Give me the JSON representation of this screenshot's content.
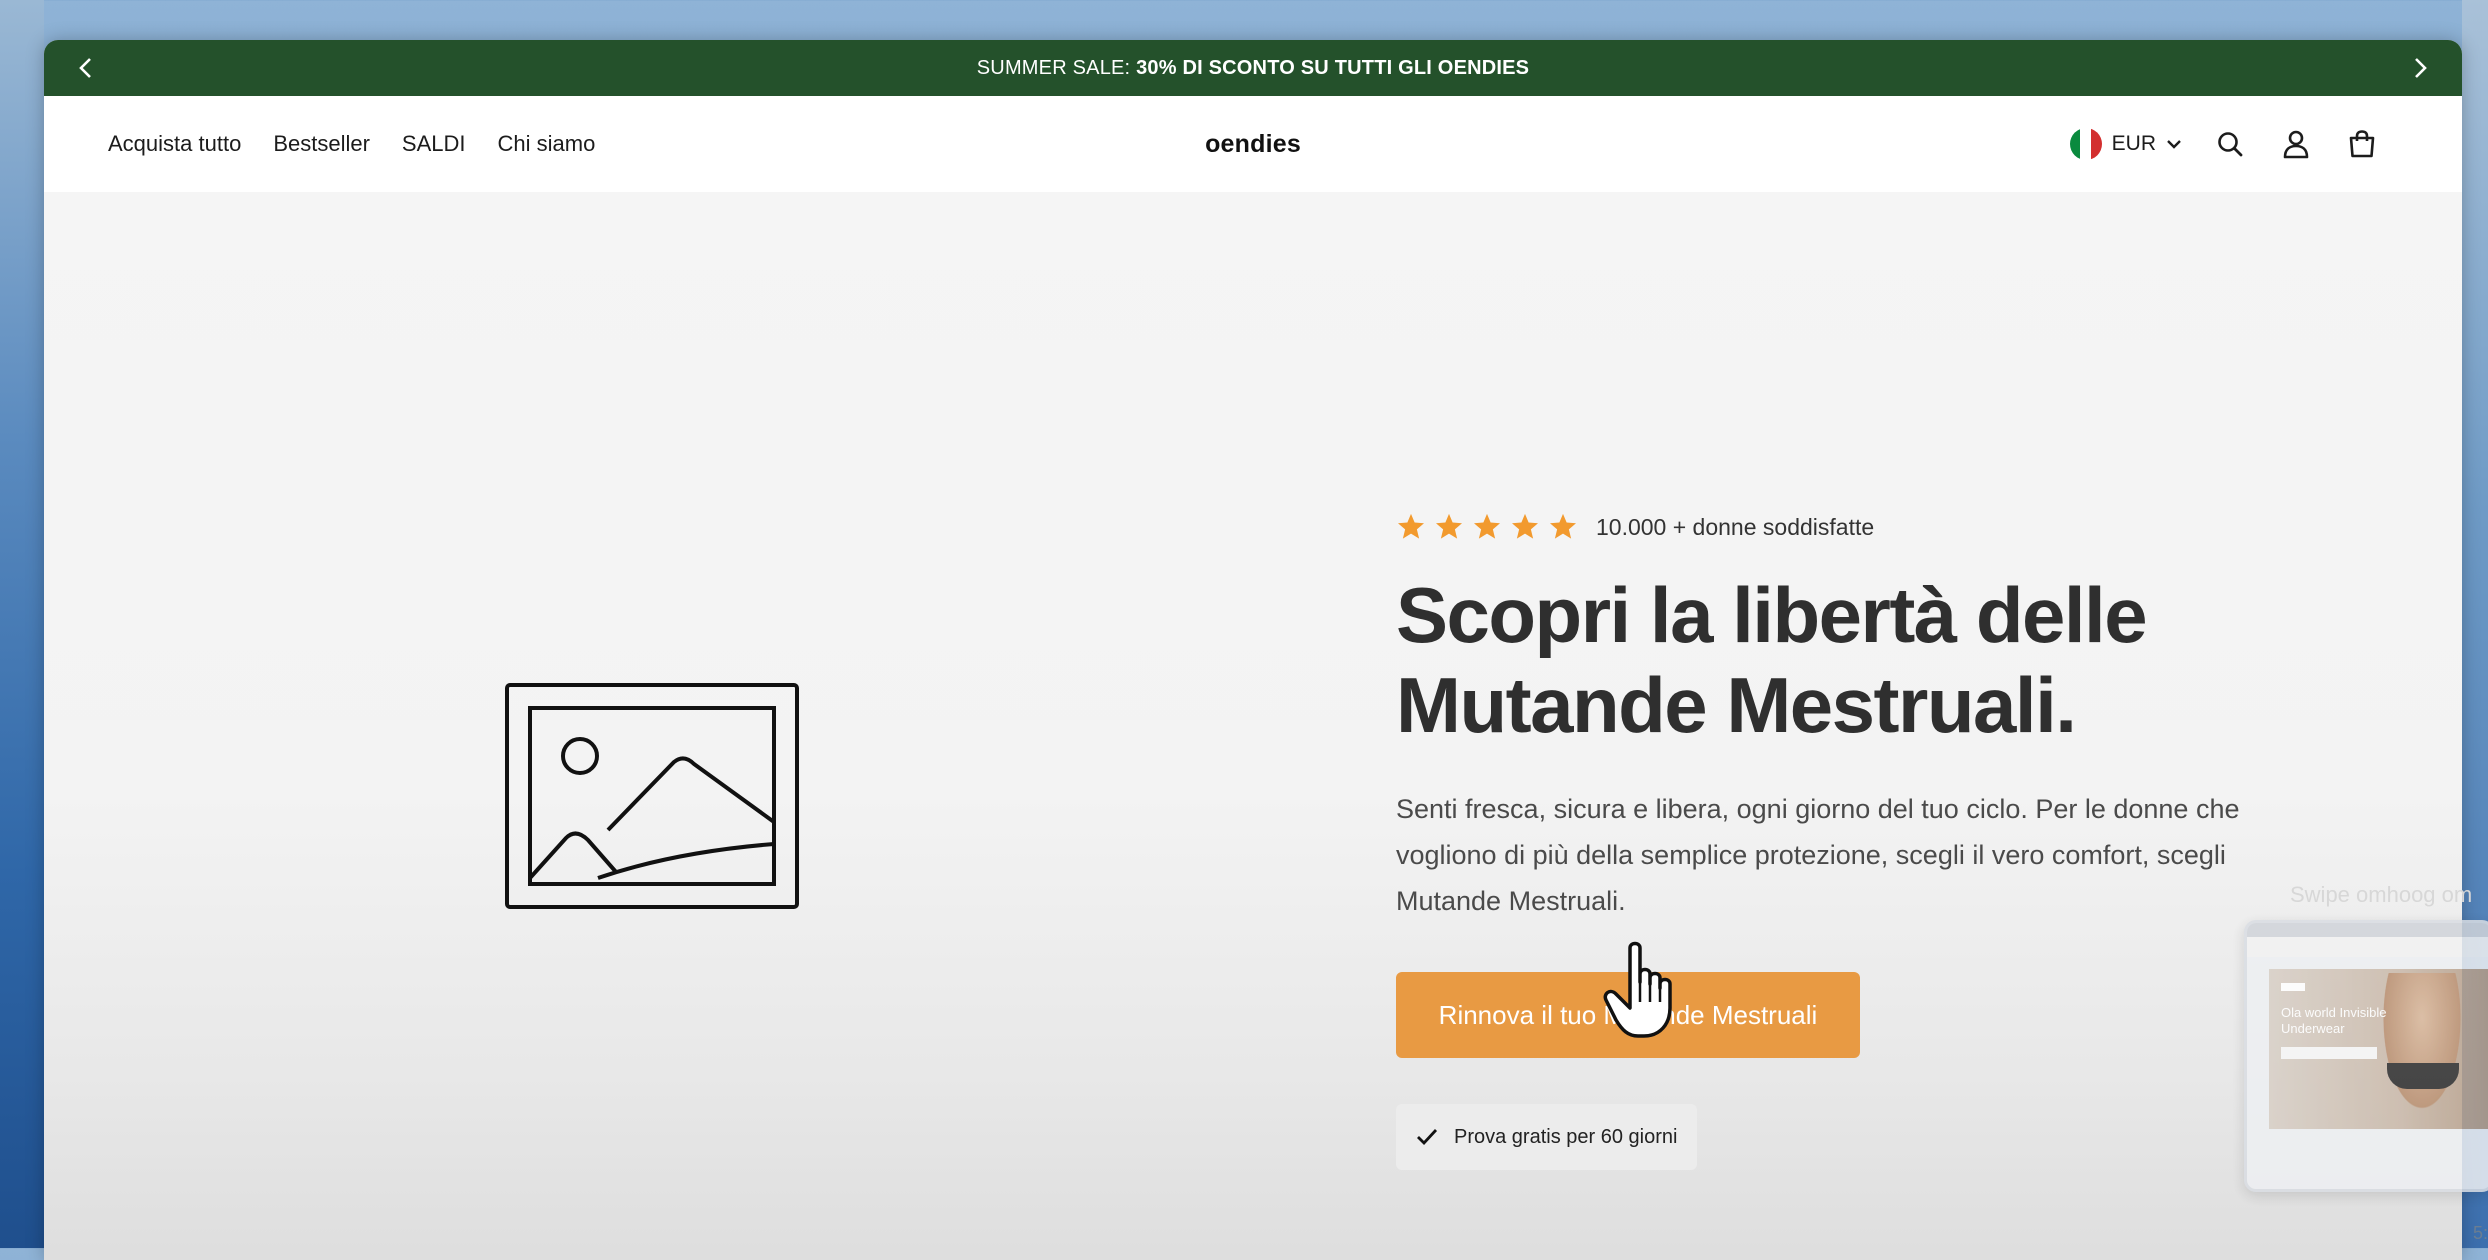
{
  "announcement": {
    "prefix": "SUMMER SALE:",
    "highlight": "30% DI SCONTO SU TUTTI GLI OENDIES",
    "prev_icon": "chevron-left-icon",
    "next_icon": "chevron-right-icon"
  },
  "nav": {
    "links": [
      "Acquista tutto",
      "Bestseller",
      "SALDI",
      "Chi siamo"
    ],
    "logo": "oendies",
    "currency": "EUR",
    "flag_icon": "italy-flag-icon",
    "icons": [
      "search-icon",
      "account-icon",
      "cart-icon"
    ]
  },
  "hero": {
    "rating_stars": 5,
    "rating_text": "10.000 + donne soddisfatte",
    "headline_line1": "Scopri la libertà delle",
    "headline_line2": "Mutande Mestruali.",
    "description": "Senti fresca, sicura e libera, ogni giorno del tuo ciclo. Per le donne che vogliono di più della semplice protezione, scegli il vero comfort, scegli Mutande Mestruali.",
    "cta_label": "Rinnova il tuo Mutande Mestruali",
    "badge_text": "Prova gratis per 60 giorni",
    "image_icon": "image-placeholder-icon"
  },
  "overlay": {
    "swipe_label": "Swipe omhoog om",
    "thumb_text": "Ola world Invisible Underwear",
    "corner_time": "5:"
  },
  "colors": {
    "announcement_bg": "#24512b",
    "cta_bg": "#e89a43",
    "star": "#f29a2e",
    "headline": "#2f2f2f"
  }
}
